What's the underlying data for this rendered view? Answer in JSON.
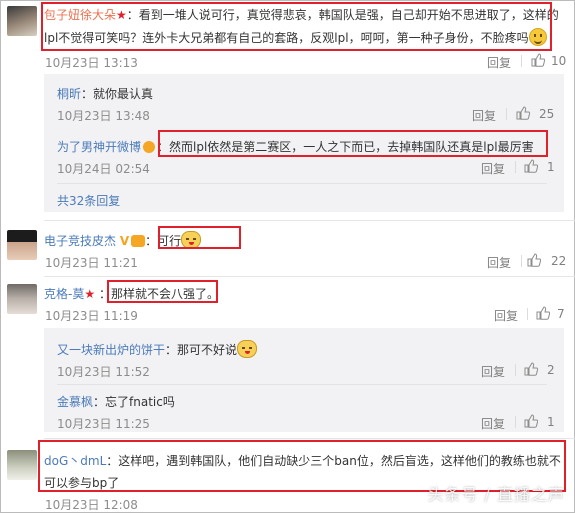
{
  "comments": [
    {
      "user": "包子妞徐大朵",
      "text_line1": "：看到一堆人说可行，真觉得悲哀，韩国队是强，自己却开始不思进取了，这样的",
      "text_line2": "lpl不觉得可笑吗？连外卡大兄弟都有自己的套路，反观lpl，呵呵，第一种子身份，不脸疼吗",
      "time": "10月23日 13:13",
      "reply_label": "回复",
      "likes": "10"
    },
    {
      "user": "电子竞技皮杰",
      "text": "：可行",
      "time": "10月23日 11:21",
      "reply_label": "回复",
      "likes": "22"
    },
    {
      "user": "克格-莫",
      "text": "：那样就不会八强了。",
      "time": "10月23日 11:19",
      "reply_label": "回复",
      "likes": "7"
    },
    {
      "user": "doG丶dmL",
      "text_line1": "：这样吧，遇到韩国队，他们自动缺少三个ban位，然后盲选，这样他们的教练也就不",
      "text_line2": "可以参与bp了",
      "time": "10月23日 12:08"
    }
  ],
  "replies_1": [
    {
      "user": "桐昕",
      "text": "：就你最认真",
      "time": "10月23日 13:48",
      "reply_label": "回复",
      "likes": "25"
    },
    {
      "user": "为了男神开微博",
      "text": "：然而lpl依然是第二赛区，一人之下而已，去掉韩国队还真是lpl最厉害",
      "time": "10月24日 02:54",
      "reply_label": "回复",
      "likes": "1"
    }
  ],
  "more_replies": "共32条回复",
  "replies_3": [
    {
      "user": "又一块新出炉的饼干",
      "text": "：那可不好说",
      "time": "10月23日 11:52",
      "reply_label": "回复",
      "likes": "2"
    },
    {
      "user": "金慕枫",
      "text": "：忘了fnatic吗",
      "time": "10月23日 11:25",
      "reply_label": "回复",
      "likes": "1"
    }
  ],
  "watermark": "头条号 / 直播之声"
}
